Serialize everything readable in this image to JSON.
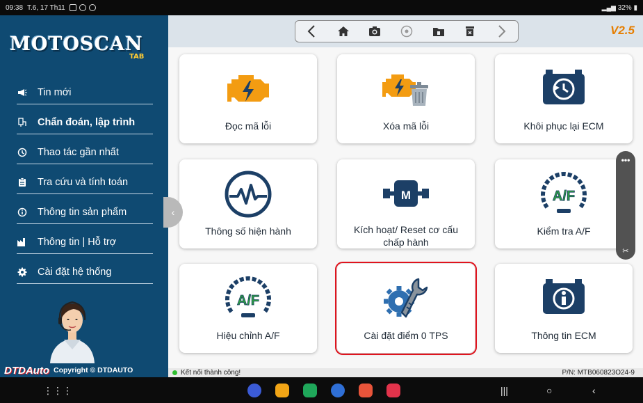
{
  "status_bar": {
    "time": "09:38",
    "date": "T.6, 17 Th11",
    "battery": "32%"
  },
  "sidebar": {
    "logo": "MOTOSCAN",
    "logo_sub": "TAB",
    "items": [
      {
        "label": "Tin mới",
        "icon": "megaphone-icon"
      },
      {
        "label": "Chẩn đoán, lập trình",
        "icon": "diagnostic-icon"
      },
      {
        "label": "Thao tác gần nhất",
        "icon": "history-icon"
      },
      {
        "label": "Tra cứu và tính toán",
        "icon": "clipboard-icon"
      },
      {
        "label": "Thông tin sản phẩm",
        "icon": "info-circle-icon"
      },
      {
        "label": "Thông tin | Hỗ trợ",
        "icon": "factory-icon"
      },
      {
        "label": "Cài đặt hệ thống",
        "icon": "gear-icon"
      }
    ],
    "footer_brand": "DTDAuto",
    "footer_copyright": "Copyright © DTDAUTO"
  },
  "toolbar": {
    "version": "V2.5"
  },
  "tiles": [
    {
      "label": "Đọc mã lỗi",
      "icon": "engine-warning-icon"
    },
    {
      "label": "Xóa mã lỗi",
      "icon": "engine-delete-icon"
    },
    {
      "label": "Khôi phục lại ECM",
      "icon": "ecm-restore-icon"
    },
    {
      "label": "Thông số hiện hành",
      "icon": "waveform-icon"
    },
    {
      "label": "Kích hoạt/ Reset cơ cấu chấp hành",
      "icon": "motor-icon"
    },
    {
      "label": "Kiểm tra A/F",
      "icon": "af-gauge-icon"
    },
    {
      "label": "Hiệu chỉnh A/F",
      "icon": "af-gauge-icon"
    },
    {
      "label": "Cài đặt điểm 0 TPS",
      "icon": "gear-wrench-icon",
      "selected": true
    },
    {
      "label": "Thông tin ECM",
      "icon": "ecm-info-icon"
    }
  ],
  "status_strip": {
    "connection": "Kết nối thành công!",
    "part_number": "P/N: MTB060823O24-9"
  },
  "colors": {
    "sidebar_bg": "#0f4a72",
    "accent_orange": "#f39c12",
    "icon_navy": "#1c3f66",
    "selection_red": "#e0141e",
    "af_green": "#2ea043"
  }
}
